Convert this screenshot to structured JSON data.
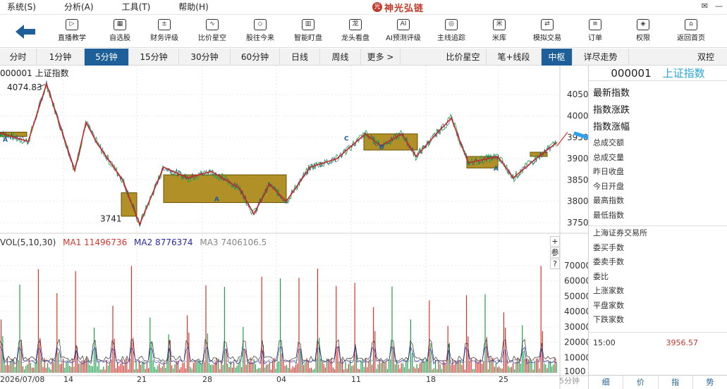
{
  "menu": [
    "系统(S)",
    "分析(A)",
    "工具(T)",
    "帮助(H)"
  ],
  "brand": {
    "name": "神光弘链"
  },
  "toolbar": [
    {
      "label": "直播教学",
      "icon": "play-icon",
      "glyph": "▷"
    },
    {
      "label": "自选股",
      "icon": "grid-icon",
      "glyph": "▦"
    },
    {
      "label": "财务评级",
      "icon": "finance-icon",
      "glyph": "±"
    },
    {
      "label": "比价星空",
      "icon": "chart-line-icon",
      "glyph": "∿"
    },
    {
      "label": "股往今来",
      "icon": "cube-icon",
      "glyph": "◇"
    },
    {
      "label": "智能盯盘",
      "icon": "monitor-icon",
      "glyph": "▥"
    },
    {
      "label": "龙头看盘",
      "icon": "dragon-icon",
      "glyph": "龙"
    },
    {
      "label": "AI预测评级",
      "icon": "ai-icon",
      "glyph": "AI"
    },
    {
      "label": "主线追踪",
      "icon": "target-icon",
      "glyph": "◎"
    },
    {
      "label": "米库",
      "icon": "rice-icon",
      "glyph": "米"
    },
    {
      "label": "模拟交易",
      "icon": "exchange-icon",
      "glyph": "⇄"
    },
    {
      "label": "订单",
      "icon": "order-icon",
      "glyph": "≡"
    },
    {
      "label": "权限",
      "icon": "shield-icon",
      "glyph": "◈"
    },
    {
      "label": "返回首页",
      "icon": "home-icon",
      "glyph": "⌂"
    }
  ],
  "period_tabs": [
    {
      "label": "分时"
    },
    {
      "label": "1分钟"
    },
    {
      "label": "5分钟",
      "active": true
    },
    {
      "label": "15分钟"
    },
    {
      "label": "30分钟"
    },
    {
      "label": "60分钟"
    },
    {
      "label": "日线"
    },
    {
      "label": "周线"
    },
    {
      "label": "更多 >"
    },
    {
      "label": "比价星空"
    },
    {
      "label": "笔+线段"
    },
    {
      "label": "中枢",
      "active": true
    },
    {
      "label": "详尽走势"
    },
    {
      "label": "双控"
    }
  ],
  "colors": {
    "up": "#d9342b",
    "down": "#1aa34a",
    "accent": "#1f5f99",
    "zone": "#a8850f",
    "ma2": "#2a2aa8"
  },
  "kline": {
    "title": "000001 上证指数",
    "high_label": "4074.83",
    "low_label": "3741",
    "y_ticks": [
      "4050",
      "4000",
      "3950",
      "3900",
      "3850",
      "3800",
      "3750"
    ],
    "ylim": [
      3735,
      4085
    ],
    "stroke_points": [
      [
        0,
        3960
      ],
      [
        40,
        3940
      ],
      [
        66,
        4075
      ],
      [
        106,
        3872
      ],
      [
        122,
        3985
      ],
      [
        138,
        3935
      ],
      [
        174,
        3850
      ],
      [
        198,
        3746
      ],
      [
        232,
        3880
      ],
      [
        266,
        3855
      ],
      [
        300,
        3870
      ],
      [
        340,
        3830
      ],
      [
        360,
        3770
      ],
      [
        382,
        3840
      ],
      [
        406,
        3800
      ],
      [
        440,
        3880
      ],
      [
        478,
        3900
      ],
      [
        518,
        3958
      ],
      [
        540,
        3930
      ],
      [
        570,
        3958
      ],
      [
        590,
        3905
      ],
      [
        620,
        3960
      ],
      [
        640,
        3995
      ],
      [
        664,
        3890
      ],
      [
        706,
        3905
      ],
      [
        728,
        3855
      ],
      [
        760,
        3900
      ],
      [
        790,
        3938
      ]
    ],
    "zones": [
      {
        "x0": 0,
        "x1": 38,
        "y_low": 3952,
        "y_high": 3962
      },
      {
        "x0": 172,
        "x1": 194,
        "y_low": 3765,
        "y_high": 3820
      },
      {
        "x0": 232,
        "x1": 406,
        "y_low": 3797,
        "y_high": 3862
      },
      {
        "x0": 516,
        "x1": 592,
        "y_low": 3920,
        "y_high": 3958
      },
      {
        "x0": 662,
        "x1": 706,
        "y_low": 3878,
        "y_high": 3905
      },
      {
        "x0": 752,
        "x1": 776,
        "y_low": 3905,
        "y_high": 3915
      }
    ],
    "arrows": [
      [
        [
          790,
          3930
        ],
        [
          805,
          3962
        ]
      ],
      [
        [
          814,
          3960
        ],
        [
          978,
          3870
        ]
      ],
      [
        [
          836,
          3955
        ],
        [
          842,
          3918
        ]
      ],
      [
        [
          858,
          3948
        ],
        [
          864,
          3905
        ]
      ],
      [
        [
          900,
          3928
        ],
        [
          918,
          3960
        ]
      ],
      [
        [
          928,
          3962
        ],
        [
          958,
          3880
        ]
      ]
    ],
    "markers": [
      {
        "x": 4,
        "y": 3940,
        "text": "A"
      },
      {
        "x": 304,
        "y": 3800,
        "text": "A"
      },
      {
        "x": 488,
        "y": 3942,
        "text": "C"
      },
      {
        "x": 538,
        "y": 3922,
        "text": "B"
      },
      {
        "x": 700,
        "y": 3872,
        "text": "A"
      }
    ]
  },
  "volume": {
    "label": "VOL(5,10,30)",
    "ma1": "MA1 11496736",
    "ma2": "MA2 8776374",
    "ma3": "MA3 7406106.5",
    "y_ticks": [
      "70000",
      "60000",
      "50000",
      "40000",
      "30000",
      "20000",
      "10000",
      "1000"
    ],
    "ylim": [
      0,
      80000
    ]
  },
  "x_labels": [
    {
      "x": 0,
      "text": "2026/07/08"
    },
    {
      "x": 90,
      "text": "14"
    },
    {
      "x": 194,
      "text": "21"
    },
    {
      "x": 287,
      "text": "28"
    },
    {
      "x": 392,
      "text": "04"
    },
    {
      "x": 498,
      "text": "11"
    },
    {
      "x": 604,
      "text": "18"
    },
    {
      "x": 707,
      "text": "25"
    }
  ],
  "period_label": "5分钟",
  "side_buttons": [
    "+",
    "参",
    "?"
  ],
  "panel": {
    "code": "000001",
    "name": "上证指数",
    "big_fields": [
      "最新指数",
      "指数涨跌",
      "指数涨幅"
    ],
    "fields": [
      "总成交额",
      "总成交量",
      "昨日收盘",
      "今日开盘",
      "最高指数",
      "最低指数"
    ],
    "exchange_fields": [
      "上海证券交易所",
      "委买手数",
      "委卖手数",
      "委比",
      "上涨家数",
      "平盘家数",
      "下跌家数"
    ],
    "time": "15:00",
    "price": "3956.57",
    "tabs": [
      "细",
      "价",
      "指",
      "势"
    ]
  }
}
